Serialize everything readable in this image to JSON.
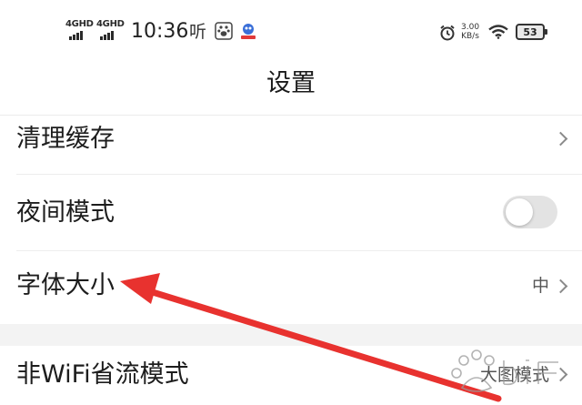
{
  "status_bar": {
    "sim1_label": "4GHD",
    "sim2_label": "4GHD",
    "time": "10:36",
    "listen_icon_text": "听",
    "speed_value": "3.00",
    "speed_unit": "KB/s",
    "battery": "53",
    "icons": [
      "signal-icon",
      "signal-icon",
      "paw-icon",
      "app-badge-icon",
      "alarm-icon",
      "wifi-icon",
      "battery-icon"
    ]
  },
  "header": {
    "title": "设置"
  },
  "settings": [
    {
      "label": "清理缓存",
      "control": "chevron"
    },
    {
      "label": "夜间模式",
      "control": "toggle",
      "toggle_on": false
    },
    {
      "label": "字体大小",
      "value": "中",
      "control": "chevron"
    },
    {
      "label": "非WiFi省流模式",
      "value": "大图模式",
      "control": "chevron"
    }
  ],
  "annotation": {
    "arrow_color": "#e8322f",
    "points_to": "字体大小"
  },
  "watermark": {
    "text": "Baidu经验"
  }
}
